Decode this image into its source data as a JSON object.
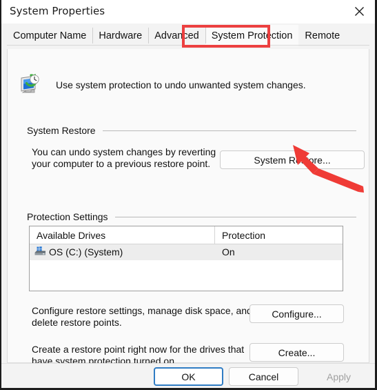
{
  "window": {
    "title": "System Properties",
    "close_icon": "close-icon"
  },
  "tabs": [
    {
      "label": "Computer Name",
      "selected": false
    },
    {
      "label": "Hardware",
      "selected": false
    },
    {
      "label": "Advanced",
      "selected": false
    },
    {
      "label": "System Protection",
      "selected": true
    },
    {
      "label": "Remote",
      "selected": false
    }
  ],
  "intro": {
    "icon": "system-protection-icon",
    "text": "Use system protection to undo unwanted system changes."
  },
  "system_restore": {
    "group_label": "System Restore",
    "description_line1": "You can undo system changes by reverting",
    "description_line2": "your computer to a previous restore point.",
    "button_label": "System Restore..."
  },
  "protection_settings": {
    "group_label": "Protection Settings",
    "columns": [
      "Available Drives",
      "Protection"
    ],
    "rows": [
      {
        "icon": "hard-drive-icon",
        "drive": "OS (C:) (System)",
        "protection": "On",
        "selected": true
      }
    ],
    "configure": {
      "description_line1": "Configure restore settings, manage disk space, and",
      "description_line2": "delete restore points.",
      "button_label": "Configure..."
    },
    "create": {
      "description_line1": "Create a restore point right now for the drives that",
      "description_line2": "have system protection turned on.",
      "button_label": "Create..."
    }
  },
  "footer": {
    "ok_label": "OK",
    "cancel_label": "Cancel",
    "apply_label": "Apply",
    "apply_disabled": true
  },
  "annotations": {
    "highlight_color": "#ec4040",
    "arrow_color": "#ef3b36",
    "highlighted_tab": "System Protection",
    "arrow_target": "System Restore..."
  }
}
